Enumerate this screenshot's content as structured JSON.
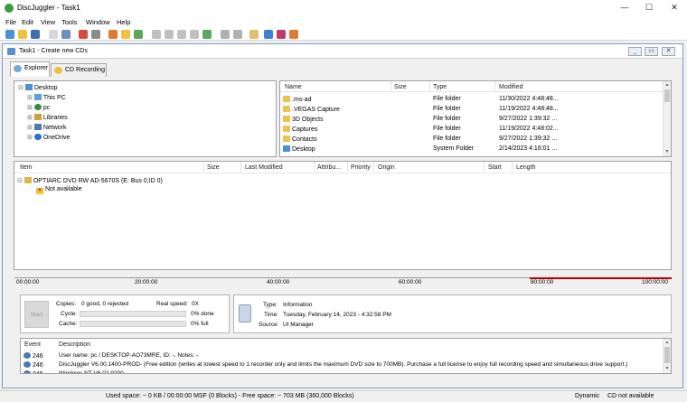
{
  "window": {
    "title": "DiscJuggler - Task1",
    "minimize": "—",
    "maximize": "☐",
    "close": "✕"
  },
  "menu": [
    "File",
    "Edit",
    "View",
    "Tools",
    "Window",
    "Help"
  ],
  "toolbar_icons": [
    "new-icon",
    "open-icon",
    "save-icon",
    "copy-icon",
    "print-icon",
    "stop-icon",
    "settings-icon",
    "wizard-icon",
    "disc-icon",
    "refresh-icon",
    "back-icon",
    "rewind-icon",
    "pause-icon",
    "play-icon",
    "record-icon",
    "eject-icon",
    "fastforward-icon",
    "info-icon",
    "help-icon",
    "home-icon"
  ],
  "mdi": {
    "title": "Task1 - Create new CDs"
  },
  "tabs": [
    {
      "label": "Explorer",
      "active": true
    },
    {
      "label": "CD Recording",
      "active": false
    }
  ],
  "tree": [
    {
      "label": "Desktop",
      "level": 0
    },
    {
      "label": "This PC",
      "level": 1
    },
    {
      "label": "pc",
      "level": 1
    },
    {
      "label": "Libraries",
      "level": 1
    },
    {
      "label": "Network",
      "level": 1
    },
    {
      "label": "OneDrive",
      "level": 1
    }
  ],
  "files": {
    "columns": [
      "Name",
      "Size",
      "Type",
      "Modified"
    ],
    "rows": [
      {
        "name": ".ms-ad",
        "size": "",
        "type": "File folder",
        "modified": "11/30/2022 4:48:48..."
      },
      {
        "name": ".VEGAS Capture",
        "size": "",
        "type": "File folder",
        "modified": "11/19/2022 4:48:48..."
      },
      {
        "name": "3D Objects",
        "size": "",
        "type": "File folder",
        "modified": "9/27/2022 1:39:32 ..."
      },
      {
        "name": "Captures",
        "size": "",
        "type": "File folder",
        "modified": "11/19/2022 4:48:02..."
      },
      {
        "name": "Contacts",
        "size": "",
        "type": "File folder",
        "modified": "9/27/2022 1:39:32 ..."
      },
      {
        "name": "Desktop",
        "size": "",
        "type": "System Folder",
        "modified": "2/14/2023 4:16:01 ..."
      }
    ]
  },
  "items": {
    "columns": [
      "Item",
      "Size",
      "Last Modified",
      "Attribu...",
      "Priority",
      "Origin",
      "Start",
      "Length"
    ],
    "drive": "OPTIARC DVD RW AD-5670S (E: Bus 0,ID 0)",
    "status": "Not available"
  },
  "timeline": {
    "marks": [
      "00:00:00",
      "20:00:00",
      "40:00:00",
      "60:00:00",
      "80:00:00",
      "100:00:00"
    ]
  },
  "progress": {
    "start_label": "Start",
    "copies_label": "Copies:",
    "copies_value": "0 good, 0 rejected",
    "speed_label": "Real speed:",
    "speed_value": "0X",
    "cycle_label": "Cycle:",
    "cycle_value": "0% done",
    "cycle_pct": 0,
    "cache_label": "Cache:",
    "cache_value": "0% full",
    "cache_pct": 0
  },
  "info": {
    "type_label": "Type:",
    "type_value": "Information",
    "time_label": "Time:",
    "time_value": "Tuesday, February 14, 2023 - 4:32:58 PM",
    "source_label": "Source:",
    "source_value": "UI Manager"
  },
  "log": {
    "columns": [
      "Event",
      "Description"
    ],
    "rows": [
      {
        "event": "246",
        "description": "User name: pc / DESKTOP-AO73MRE, ID: -, Notes: -"
      },
      {
        "event": "246",
        "description": "DiscJuggler V6.00.1400-PROD- (Free edition (writes at lowest speed to 1 recorder only and limits the maximum DVD size to 700MB). Purchase a full license to enjoy full recording speed and simultaneous drive support.)"
      },
      {
        "event": "246",
        "description": "Windows NT V6.02.9200"
      }
    ]
  },
  "statusbar": {
    "space": "Used space: ~ 0 KB / 00:00:00 MSF (0 Blocks) - Free space: ~ 703 MB (360,000 Blocks)",
    "mode": "Dynamic",
    "cd_status": "CD not available"
  },
  "colors": {
    "accent": "#7a9cc6",
    "folder": "#f2c14e",
    "timeline_red": "#c00000"
  }
}
